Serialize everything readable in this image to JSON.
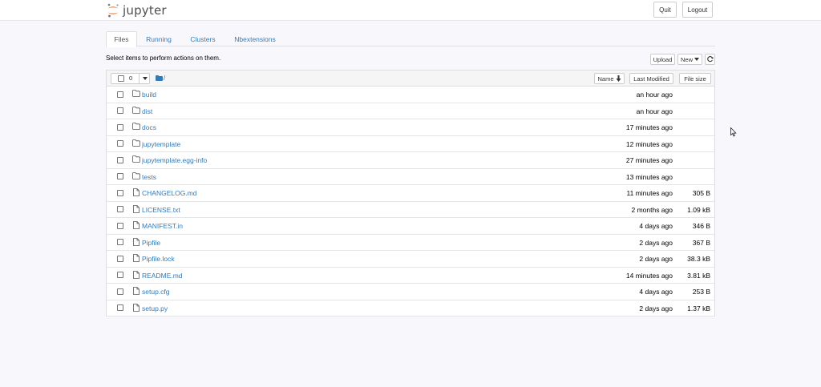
{
  "header": {
    "logo_text": "jupyter",
    "quit_label": "Quit",
    "logout_label": "Logout"
  },
  "tabs": [
    {
      "label": "Files",
      "active": true
    },
    {
      "label": "Running",
      "active": false
    },
    {
      "label": "Clusters",
      "active": false
    },
    {
      "label": "Nbextensions",
      "active": false
    }
  ],
  "toolbar": {
    "instruction": "Select items to perform actions on them.",
    "upload_label": "Upload",
    "new_label": "New",
    "refresh_icon": "refresh-icon"
  },
  "list_header": {
    "selected_count": "0",
    "path": "/",
    "sort_name_label": "Name",
    "sort_modified_label": "Last Modified",
    "sort_size_label": "File size"
  },
  "files": [
    {
      "name": "build",
      "type": "folder",
      "modified": "an hour ago",
      "size": ""
    },
    {
      "name": "dist",
      "type": "folder",
      "modified": "an hour ago",
      "size": ""
    },
    {
      "name": "docs",
      "type": "folder",
      "modified": "17 minutes ago",
      "size": ""
    },
    {
      "name": "jupytemplate",
      "type": "folder",
      "modified": "12 minutes ago",
      "size": ""
    },
    {
      "name": "jupytemplate.egg-info",
      "type": "folder",
      "modified": "27 minutes ago",
      "size": ""
    },
    {
      "name": "tests",
      "type": "folder",
      "modified": "13 minutes ago",
      "size": ""
    },
    {
      "name": "CHANGELOG.md",
      "type": "file",
      "modified": "11 minutes ago",
      "size": "305 B"
    },
    {
      "name": "LICENSE.txt",
      "type": "file",
      "modified": "2 months ago",
      "size": "1.09 kB"
    },
    {
      "name": "MANIFEST.in",
      "type": "file",
      "modified": "4 days ago",
      "size": "346 B"
    },
    {
      "name": "Pipfile",
      "type": "file",
      "modified": "2 days ago",
      "size": "367 B"
    },
    {
      "name": "Pipfile.lock",
      "type": "file",
      "modified": "2 days ago",
      "size": "38.3 kB"
    },
    {
      "name": "README.md",
      "type": "file",
      "modified": "14 minutes ago",
      "size": "3.81 kB"
    },
    {
      "name": "setup.cfg",
      "type": "file",
      "modified": "4 days ago",
      "size": "253 B"
    },
    {
      "name": "setup.py",
      "type": "file",
      "modified": "2 days ago",
      "size": "1.37 kB"
    }
  ],
  "colors": {
    "link": "#337ab7",
    "logo_orange": "#f37726",
    "background": "#f8f8fc"
  }
}
